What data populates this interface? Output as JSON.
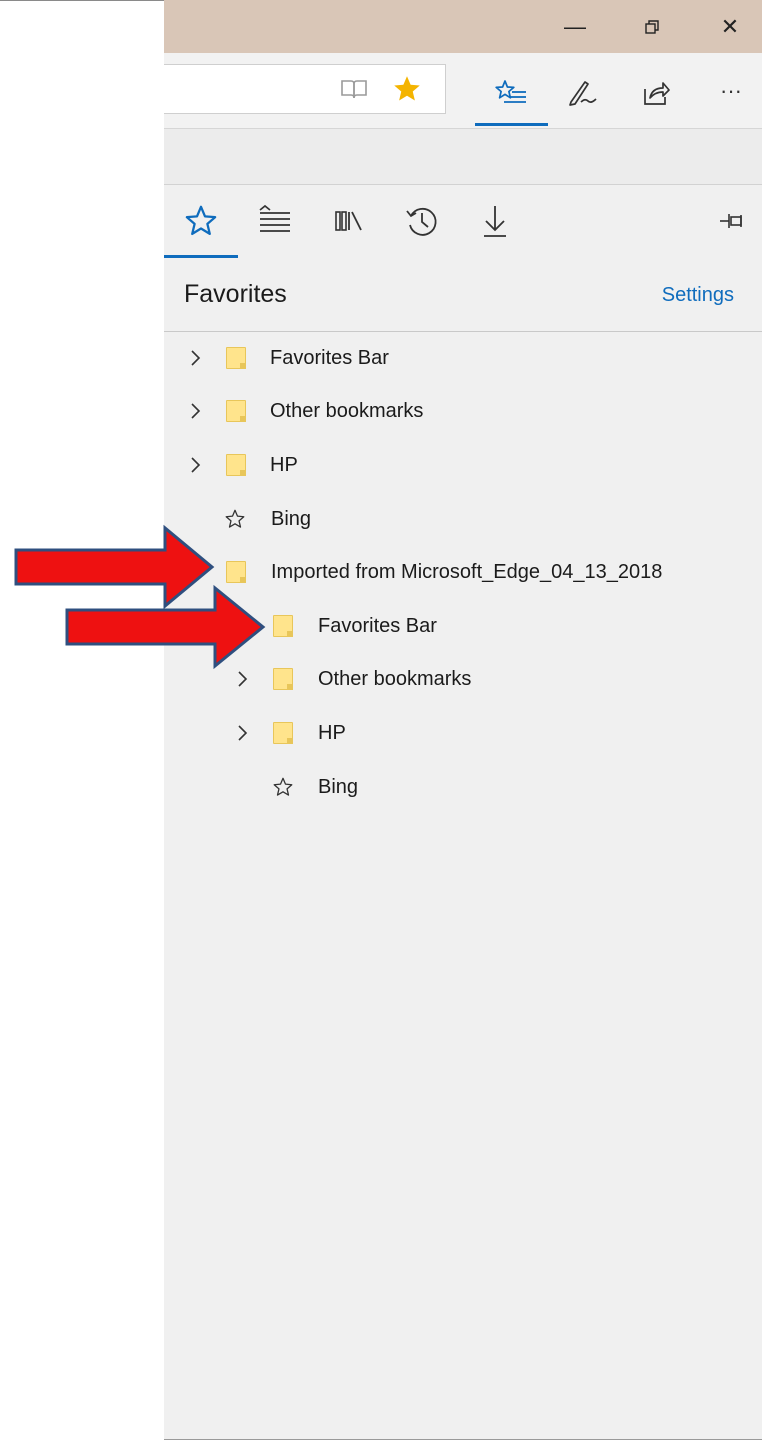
{
  "window": {
    "minimize_glyph": "—",
    "maximize_glyph": "❐",
    "close_glyph": "✕"
  },
  "toolbar": {
    "icons": [
      "reading-view-icon",
      "favorite-star-icon",
      "hub-favorites-icon",
      "notes-pen-icon",
      "share-icon",
      "more-icon"
    ],
    "more_glyph": "···"
  },
  "hub": {
    "tabs": [
      "favorites-tab",
      "reading-list-tab",
      "books-tab",
      "history-tab",
      "downloads-tab"
    ],
    "pin_icon": "pin-icon"
  },
  "panel": {
    "title": "Favorites",
    "settings_label": "Settings"
  },
  "tree": {
    "items": [
      {
        "label": "Favorites Bar",
        "type": "folder",
        "expandable": true
      },
      {
        "label": "Other bookmarks",
        "type": "folder",
        "expandable": true
      },
      {
        "label": "HP",
        "type": "folder",
        "expandable": true
      },
      {
        "label": "Bing",
        "type": "link"
      },
      {
        "label": "Imported from Microsoft_Edge_04_13_2018",
        "type": "folder",
        "expanded": true,
        "children": [
          {
            "label": "Favorites Bar",
            "type": "folder"
          },
          {
            "label": "Other bookmarks",
            "type": "folder",
            "expandable": true
          },
          {
            "label": "HP",
            "type": "folder",
            "expandable": true
          },
          {
            "label": "Bing",
            "type": "link"
          }
        ]
      }
    ]
  },
  "colors": {
    "accent": "#0f6cbd",
    "titlebar": "#d9c6b7",
    "star_gold": "#f4b400",
    "folder": "#ffe48c",
    "arrow_fill": "#ee1111",
    "arrow_stroke": "#2f4f7f"
  }
}
